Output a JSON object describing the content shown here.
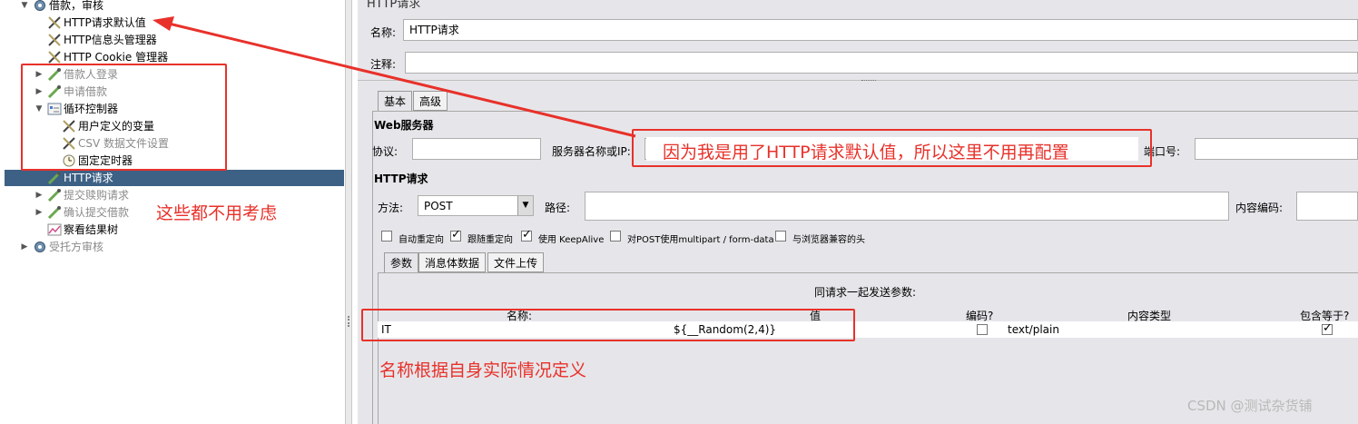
{
  "tree": {
    "items": [
      {
        "label": "借款，审核",
        "grey": false,
        "expander": "▼",
        "icon": "gear-icon"
      },
      {
        "label": "HTTP请求默认值",
        "grey": false,
        "expander": "",
        "icon": "wrench-icon"
      },
      {
        "label": "HTTP信息头管理器",
        "grey": false,
        "expander": "",
        "icon": "wrench-icon"
      },
      {
        "label": "HTTP Cookie 管理器",
        "grey": false,
        "expander": "",
        "icon": "wrench-icon"
      },
      {
        "label": "借款人登录",
        "grey": true,
        "expander": "▶",
        "icon": "pipette-icon"
      },
      {
        "label": "申请借款",
        "grey": true,
        "expander": "▶",
        "icon": "pipette-icon"
      },
      {
        "label": "循环控制器",
        "grey": false,
        "expander": "▼",
        "icon": "loop-controller-icon"
      },
      {
        "label": "用户定义的变量",
        "grey": false,
        "expander": "",
        "icon": "wrench-icon"
      },
      {
        "label": "CSV 数据文件设置",
        "grey": true,
        "expander": "",
        "icon": "wrench-icon"
      },
      {
        "label": "固定定时器",
        "grey": false,
        "expander": "",
        "icon": "clock-icon"
      },
      {
        "label": "HTTP请求",
        "grey": false,
        "expander": "",
        "icon": "pipette-icon",
        "selected": true
      },
      {
        "label": "提交赎购请求",
        "grey": true,
        "expander": "▶",
        "icon": "pipette-icon"
      },
      {
        "label": "确认提交借款",
        "grey": true,
        "expander": "▶",
        "icon": "pipette-icon"
      },
      {
        "label": "察看结果树",
        "grey": false,
        "expander": "",
        "icon": "chart-icon"
      },
      {
        "label": "受托方审核",
        "grey": true,
        "expander": "▶",
        "icon": "gear-icon"
      }
    ]
  },
  "panel": {
    "title": "HTTP请求",
    "name_label": "名称:",
    "name_value": "HTTP请求",
    "comment_label": "注释:",
    "comment_value": "",
    "tabs": [
      "基本",
      "高级"
    ],
    "web_server": {
      "section": "Web服务器",
      "protocol_label": "协议:",
      "server_label": "服务器名称或IP:",
      "port_label": "端口号:"
    },
    "http_request": {
      "section": "HTTP请求",
      "method_label": "方法:",
      "method_value": "POST",
      "path_label": "路径:",
      "encoding_label": "内容编码:",
      "options": [
        {
          "label": "自动重定向",
          "checked": false
        },
        {
          "label": "跟随重定向",
          "checked": true
        },
        {
          "label": "使用 KeepAlive",
          "checked": true
        },
        {
          "label": "对POST使用multipart / form-data",
          "checked": false
        },
        {
          "label": "与浏览器兼容的头",
          "checked": false
        }
      ],
      "subtabs": [
        "参数",
        "消息体数据",
        "文件上传"
      ]
    },
    "params": {
      "caption": "同请求一起发送参数:",
      "columns": [
        "名称:",
        "值",
        "编码?",
        "内容类型",
        "包含等于?"
      ],
      "rows": [
        {
          "name": "IT",
          "value": "${__Random(2,4)}",
          "encode": false,
          "content_type": "text/plain",
          "include_equals": true
        }
      ]
    }
  },
  "annotations": {
    "server_note": "因为我是用了HTTP请求默认值，所以这里不用再配置",
    "ignore_note": "这些都不用考虑",
    "name_note": "名称根据自身实际情况定义",
    "color": "#e8312a"
  },
  "watermark": "CSDN @测试杂货铺"
}
